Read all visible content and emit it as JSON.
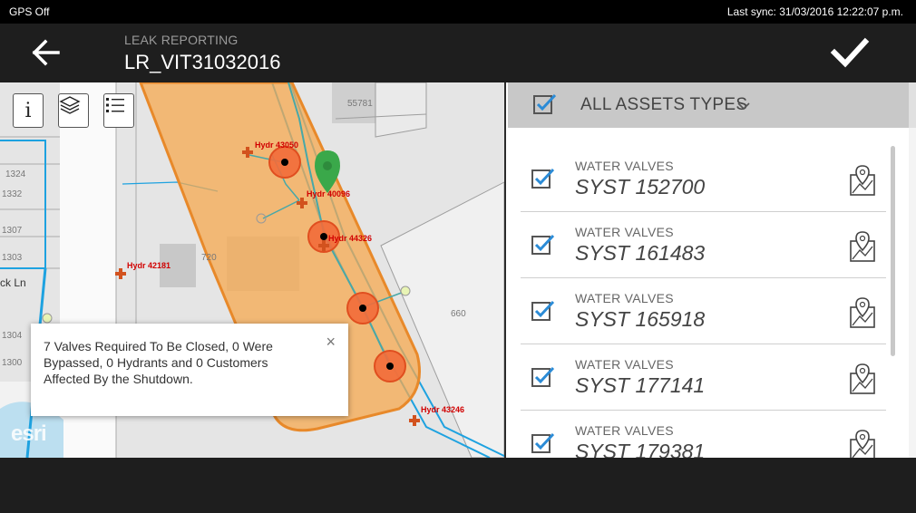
{
  "status_bar": {
    "gps": "GPS Off",
    "last_sync": "Last sync: 31/03/2016 12:22:07 p.m."
  },
  "header": {
    "subtitle": "LEAK REPORTING",
    "title": "LR_VIT31032016"
  },
  "map": {
    "labels": {
      "hydr_43050": "Hydr 43050",
      "hydr_40096": "Hydr 40096",
      "hydr_44326": "Hydr 44326",
      "hydr_42181": "Hydr 42181",
      "hydr_43246": "Hydr 43246",
      "parcel_55781": "55781",
      "parcel_720": "720",
      "parcel_660": "660",
      "parcel_1324": "1324",
      "parcel_1332": "1332",
      "parcel_1307": "1307",
      "parcel_1303": "1303",
      "parcel_1304": "1304",
      "parcel_1300": "1300",
      "street": "ck Ln"
    },
    "tools": {
      "info_glyph": "i"
    },
    "popup": {
      "text": "7 Valves Required To Be Closed, 0 Were Bypassed, 0 Hydrants and 0 Customers Affected By the Shutdown.",
      "close": "×"
    },
    "attribution": "esri"
  },
  "asset_panel": {
    "header_label": "ALL ASSETS TYPES",
    "items": [
      {
        "type": "WATER VALVES",
        "id": "SYST 152700"
      },
      {
        "type": "WATER VALVES",
        "id": "SYST 161483"
      },
      {
        "type": "WATER VALVES",
        "id": "SYST 165918"
      },
      {
        "type": "WATER VALVES",
        "id": "SYST 177141"
      },
      {
        "type": "WATER VALVES",
        "id": "SYST 179381"
      }
    ]
  },
  "colors": {
    "buffer_fill": "#f6a84f",
    "buffer_stroke": "#e8892a",
    "valve_marker": "#f26b3a",
    "water_main": "#1ea2e0",
    "checkbox": "#2b8bd6",
    "selected_hydrant": "#3aa84a"
  },
  "icons": {
    "back": "arrow-left-icon",
    "confirm": "checkmark-icon",
    "info": "info-icon",
    "layers": "layers-icon",
    "legend": "legend-list-icon",
    "checkbox": "checkbox-checked-icon",
    "dropdown": "chevron-down-icon",
    "zoom_to": "map-pin-zoom-icon"
  }
}
